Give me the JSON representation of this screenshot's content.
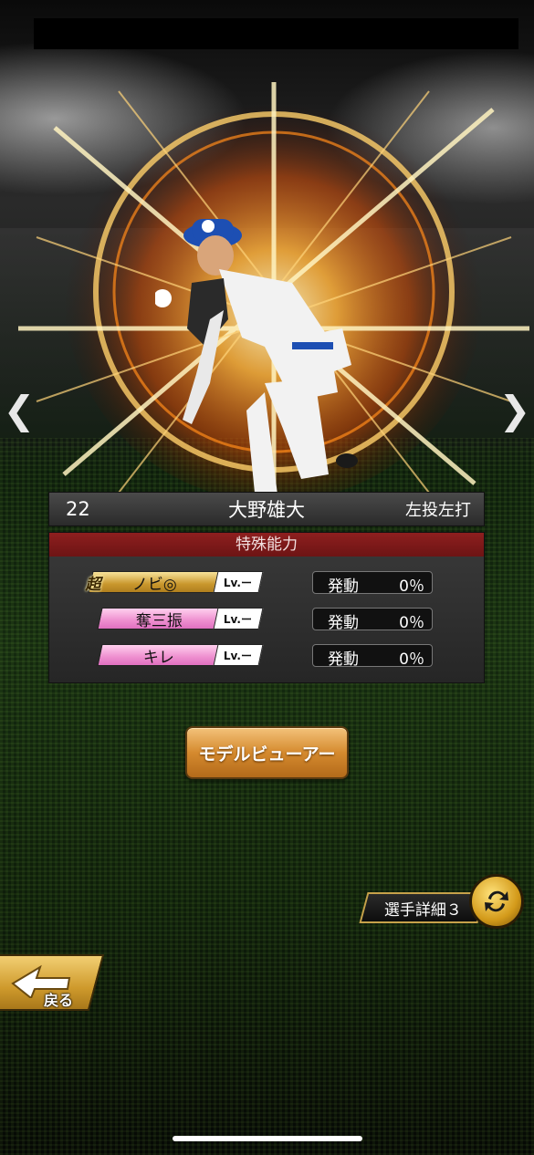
{
  "player": {
    "number": "22",
    "name": "大野雄大",
    "handedness": "左投左打"
  },
  "abilities": {
    "header": "特殊能力",
    "lv_label": "Lv.ー",
    "activation_label": "発動",
    "super_badge": "超",
    "items": [
      {
        "name": "ノビ◎",
        "rarity": "gold",
        "activation": "0％"
      },
      {
        "name": "奪三振",
        "rarity": "pink",
        "activation": "0％"
      },
      {
        "name": "キレ",
        "rarity": "pink",
        "activation": "0％"
      }
    ]
  },
  "buttons": {
    "model_viewer": "モデルビューアー",
    "player_detail": "選手詳細３",
    "back": "戻る"
  },
  "nav": {
    "prev_icon": "chevron-left-icon",
    "next_icon": "chevron-right-icon"
  },
  "colors": {
    "ability_header": "#7d1a1a",
    "gold": "#d3a43c",
    "pink": "#ee8fcf",
    "burst": "#ff9a1a"
  }
}
